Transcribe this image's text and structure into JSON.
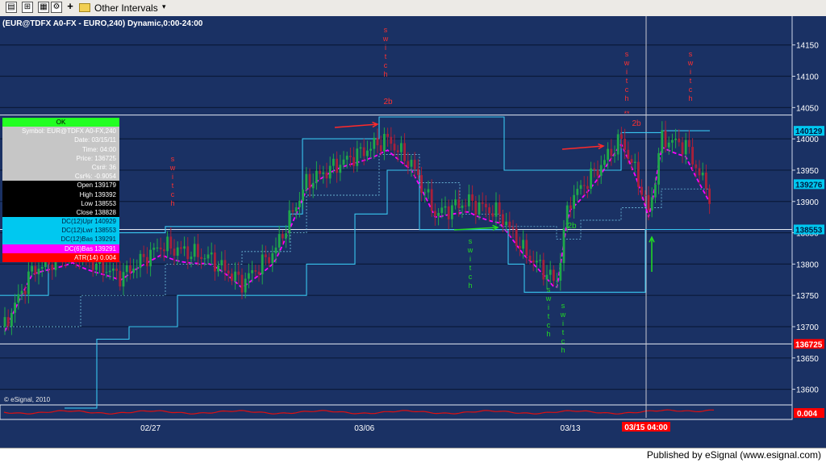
{
  "toolbar": {
    "interval_label": "Other Intervals",
    "caret": "▾",
    "add_glyph": "+"
  },
  "chart_data": {
    "type": "candlestick",
    "title": "(EUR@TDFX A0-FX - EURO,240) Dynamic,0:00-24:00",
    "watermark": "© eSignal, 2010",
    "y_ticks": [
      {
        "value": 13600,
        "label": "13600"
      },
      {
        "value": 13650,
        "label": "13650"
      },
      {
        "value": 13700,
        "label": "13700"
      },
      {
        "value": 13750,
        "label": "13750"
      },
      {
        "value": 13800,
        "label": "13800"
      },
      {
        "value": 13850,
        "label": "13850"
      },
      {
        "value": 13900,
        "label": "13900"
      },
      {
        "value": 13950,
        "label": "13950"
      },
      {
        "value": 14000,
        "label": "14000"
      },
      {
        "value": 14050,
        "label": "14050"
      },
      {
        "value": 14100,
        "label": "14100"
      },
      {
        "value": 14150,
        "label": "14150"
      }
    ],
    "y_range": [
      13575,
      14178
    ],
    "x_labels": [
      {
        "position": 0.19,
        "label": "02/27"
      },
      {
        "position": 0.46,
        "label": "03/06"
      },
      {
        "position": 0.72,
        "label": "03/13"
      }
    ],
    "cursor_label": "03/15 04:00",
    "price_tags": [
      {
        "value": 14012.9,
        "label": "140129",
        "bg": "#00c8f0",
        "fg": "#001a40"
      },
      {
        "value": 13927.6,
        "label": "139276",
        "bg": "#00c8f0",
        "fg": "#001a40"
      },
      {
        "value": 13855.3,
        "label": "138553",
        "bg": "#00c8f0",
        "fg": "#001a40"
      },
      {
        "value": 13672.5,
        "label": "136725",
        "bg": "#ff0000",
        "fg": "#ffffff"
      }
    ],
    "atr_tag": "0.004",
    "annotations": {
      "switch_word": "switch",
      "two_b": "2b",
      "double_star": "**"
    },
    "series": [
      {
        "name": "Donchian 12 channel",
        "color": "#39c6f0"
      },
      {
        "name": "Donchian 6 basis",
        "color": "#ff00ff"
      },
      {
        "name": "ATR(14)",
        "color": "#e01010"
      }
    ],
    "colors": {
      "background": "#1a3164",
      "grid": "#0b1a3a",
      "up_candle": "#1fa84a",
      "down_candle": "#a8203a"
    }
  },
  "info_panel": {
    "ok": "OK",
    "symbol": "Symbol: EUR@TDFX A0-FX,240",
    "date": "Date: 03/15/11",
    "time": "Time: 04:00",
    "price": "Price: 136725",
    "csr": "Csr#: 36",
    "csr_pct": "Csr%: -0.9054",
    "open": "Open 139179",
    "high": "High 139392",
    "low": "Low 138553",
    "close": "Close 138828",
    "dc_upr": "DC(12)Upr 140929",
    "dc_lwr": "DC(12)Lwr 138553",
    "dc_bas": "DC(12)Bas 139291",
    "dc6_bas": "DC(6)Bas 139291",
    "atr": "ATR(14) 0.004"
  },
  "footer": {
    "published": "Published by eSignal (www.esignal.com)"
  }
}
